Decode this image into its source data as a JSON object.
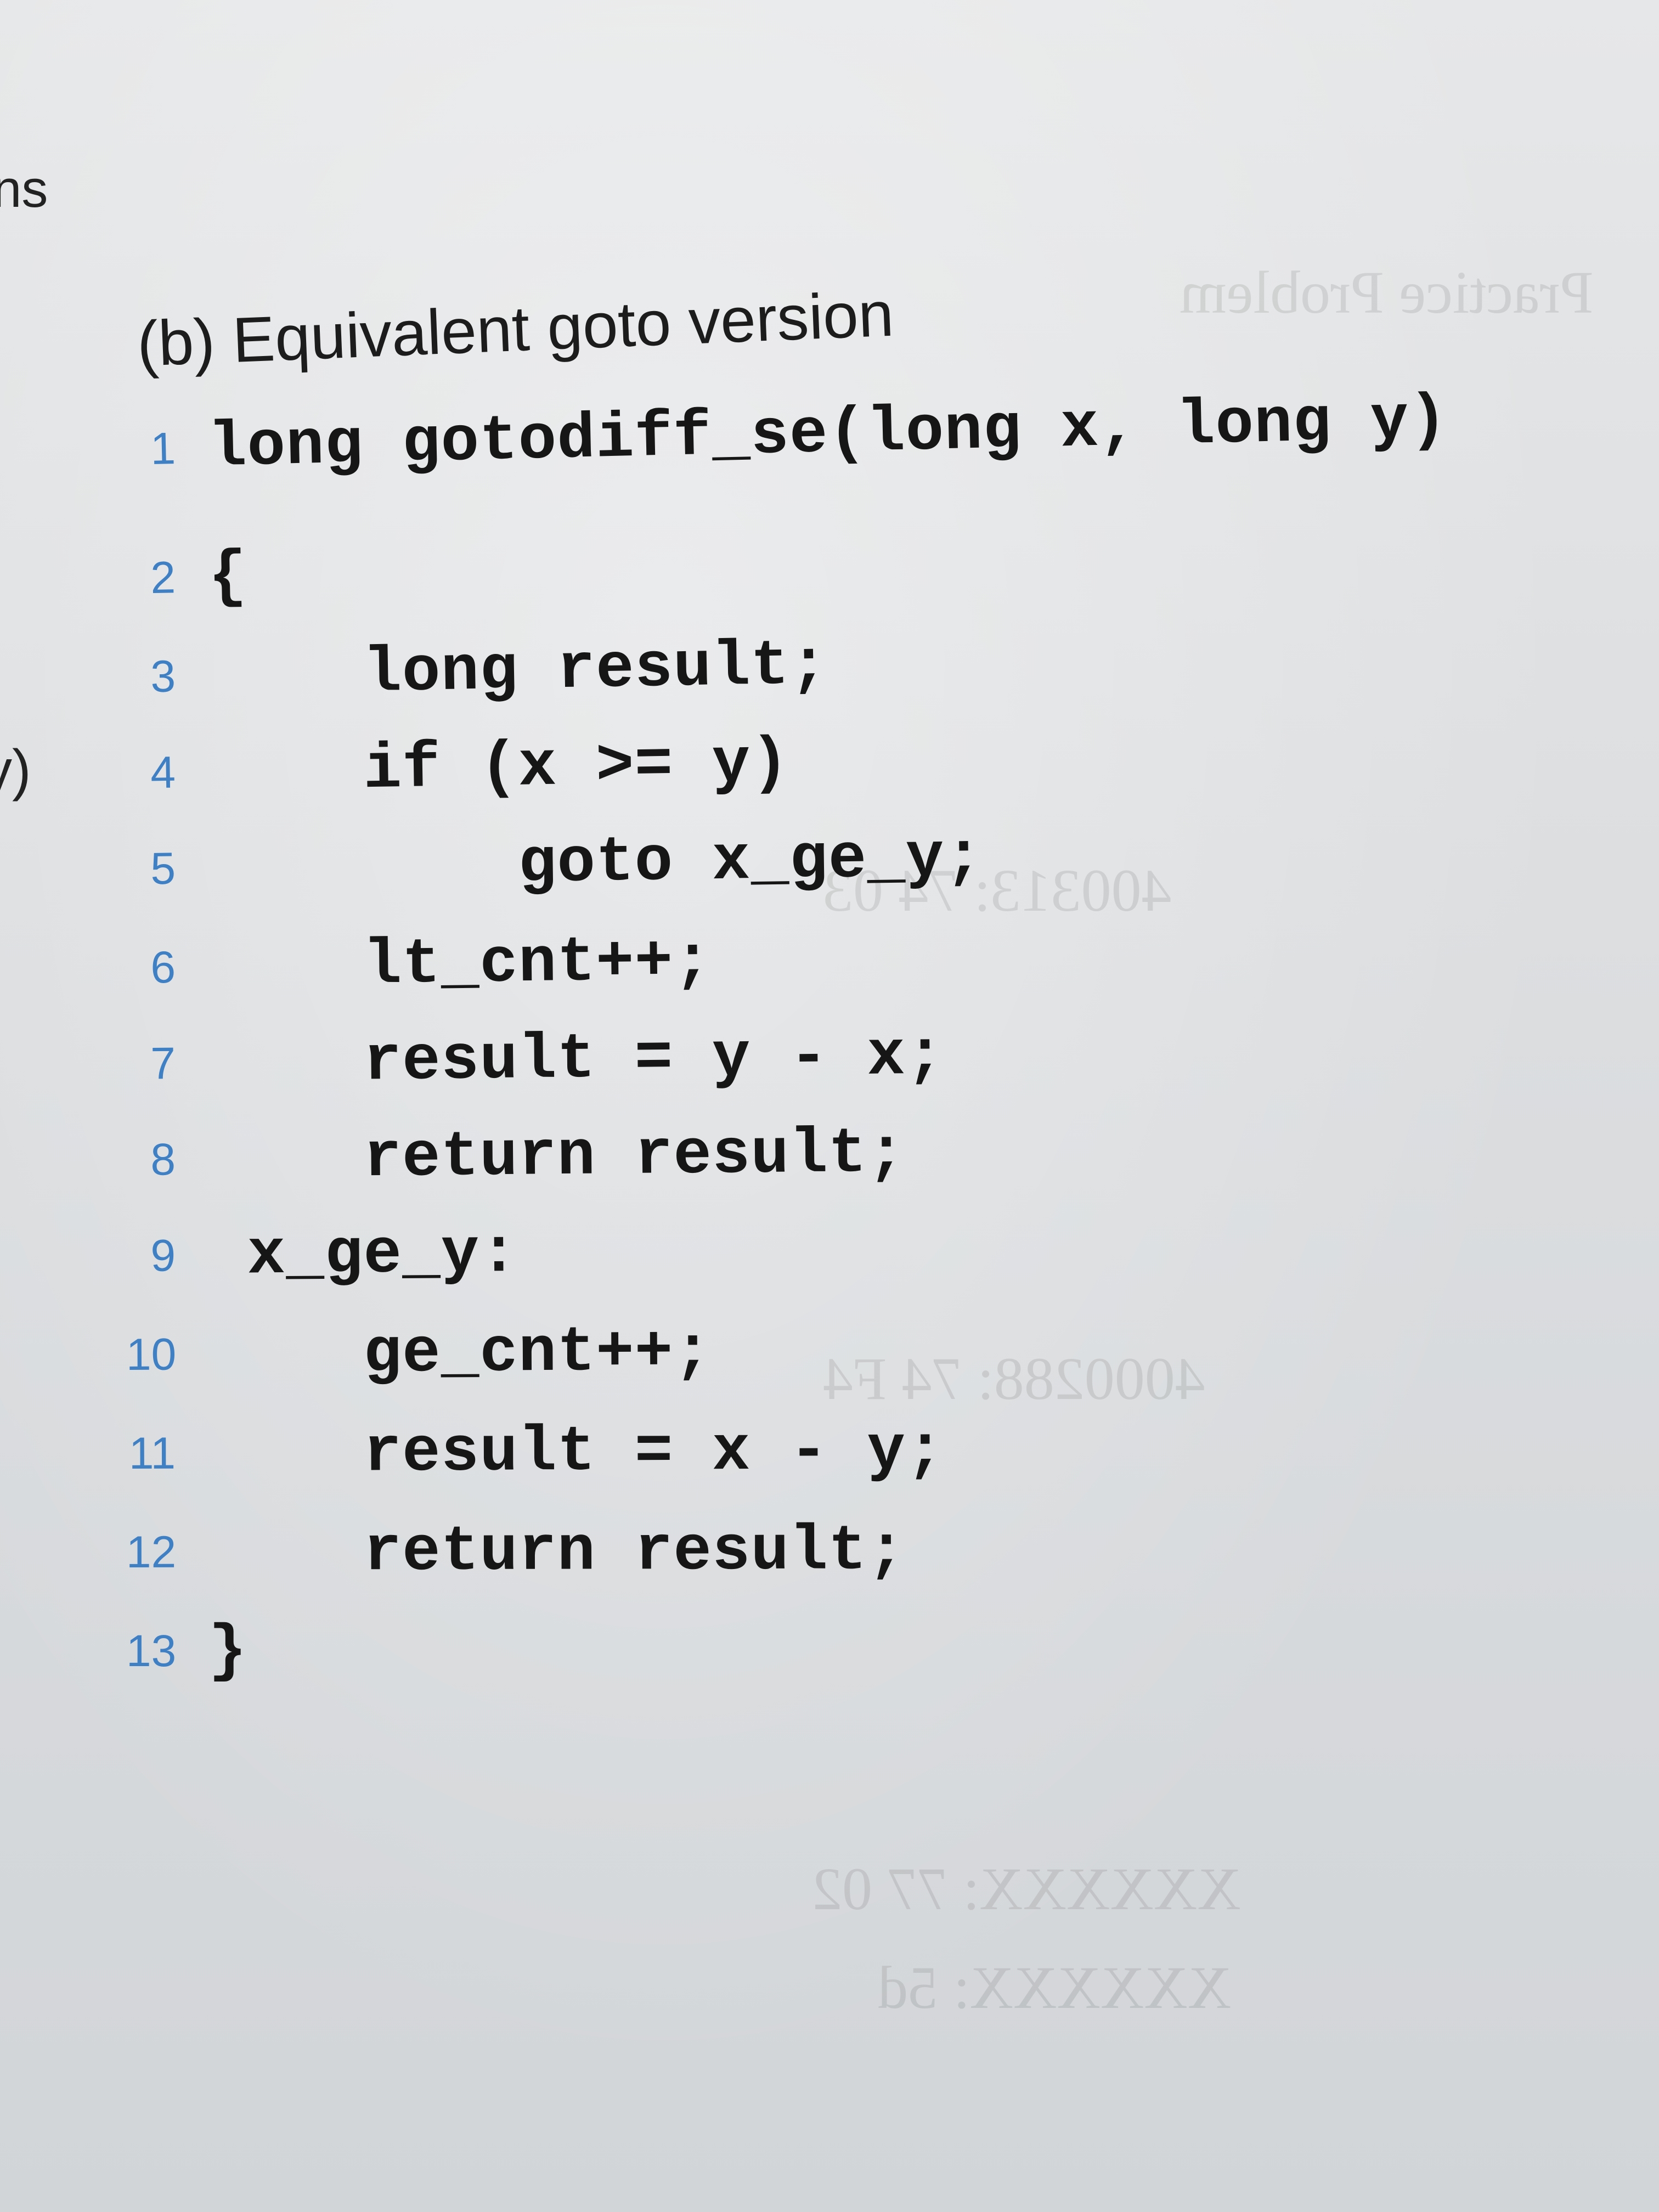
{
  "margin_fragments": {
    "top": "ns",
    "middle": "y)"
  },
  "caption": "(b) Equivalent goto version",
  "code_lines": [
    {
      "number": "1",
      "text": "long gotodiff_se(long x, long y)"
    },
    {
      "number": "2",
      "text": "{"
    },
    {
      "number": "3",
      "text": "    long result;"
    },
    {
      "number": "4",
      "text": "    if (x >= y)"
    },
    {
      "number": "5",
      "text": "        goto x_ge_y;"
    },
    {
      "number": "6",
      "text": "    lt_cnt++;"
    },
    {
      "number": "7",
      "text": "    result = y - x;"
    },
    {
      "number": "8",
      "text": "    return result;"
    },
    {
      "number": "9",
      "text": " x_ge_y:"
    },
    {
      "number": "10",
      "text": "    ge_cnt++;"
    },
    {
      "number": "11",
      "text": "    result = x - y;"
    },
    {
      "number": "12",
      "text": "    return result;"
    },
    {
      "number": "13",
      "text": "}"
    }
  ],
  "colors": {
    "line_number": "#3f7fc4",
    "code_text": "#161616",
    "paper": "#e2e3e4"
  }
}
